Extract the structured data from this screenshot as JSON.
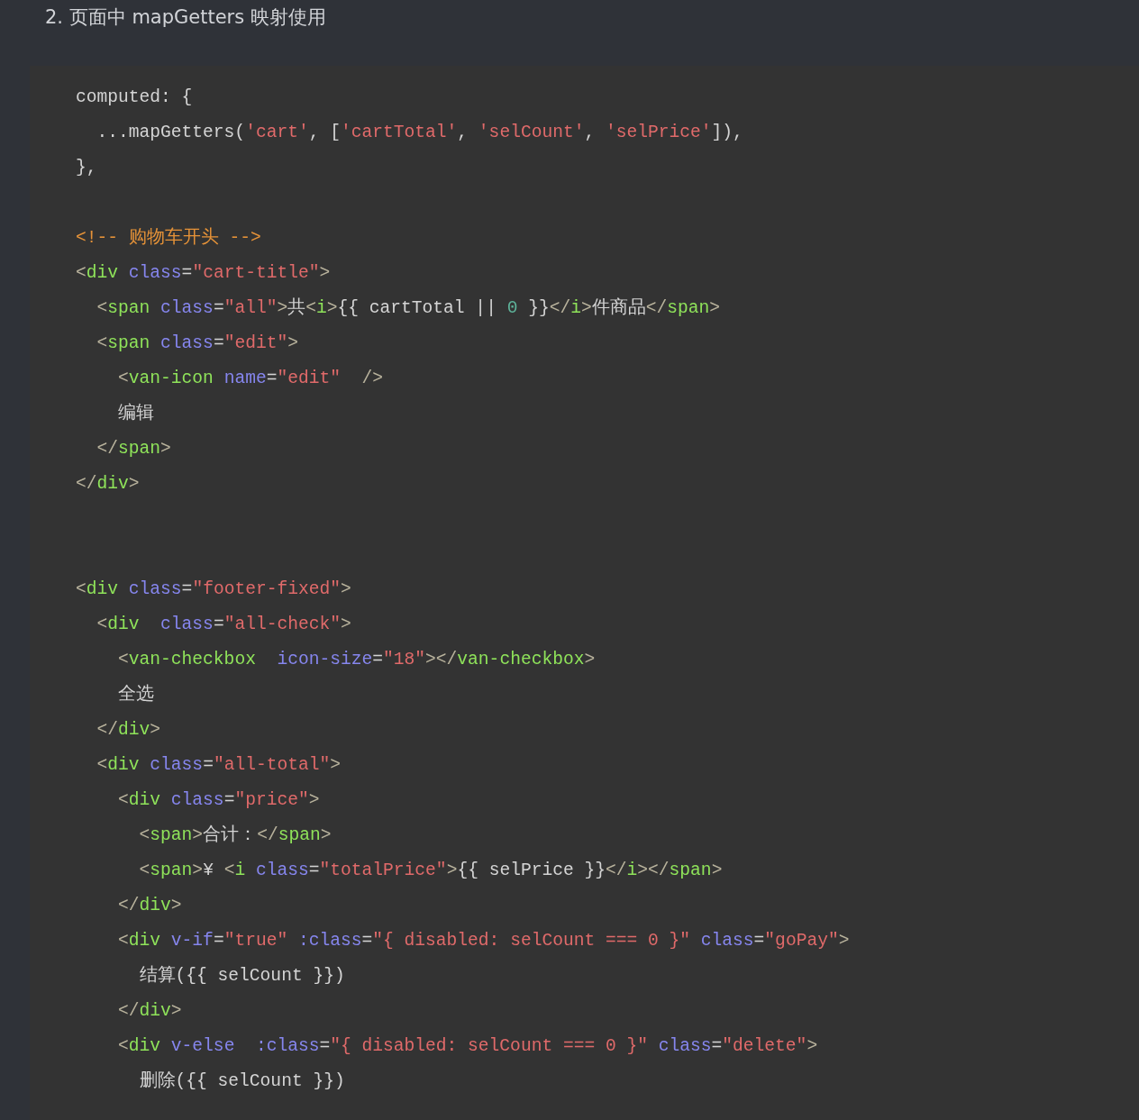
{
  "heading": "2. 页面中 mapGetters 映射使用",
  "code": {
    "lines": [
      {
        "kind": "code",
        "tokens": [
          {
            "kind": "plain",
            "text": "computed: {"
          }
        ]
      },
      {
        "kind": "code",
        "tokens": [
          {
            "kind": "plain",
            "text": "  ...mapGetters("
          },
          {
            "kind": "string",
            "text": "'cart'"
          },
          {
            "kind": "plain",
            "text": ", ["
          },
          {
            "kind": "string",
            "text": "'cartTotal'"
          },
          {
            "kind": "plain",
            "text": ", "
          },
          {
            "kind": "string",
            "text": "'selCount'"
          },
          {
            "kind": "plain",
            "text": ", "
          },
          {
            "kind": "string",
            "text": "'selPrice'"
          },
          {
            "kind": "plain",
            "text": "]),"
          }
        ]
      },
      {
        "kind": "code",
        "tokens": [
          {
            "kind": "plain",
            "text": "},"
          }
        ]
      },
      {
        "kind": "blank"
      },
      {
        "kind": "code",
        "tokens": [
          {
            "kind": "comment",
            "text": "<!-- 购物车开头 -->"
          }
        ]
      },
      {
        "kind": "code",
        "tokens": [
          {
            "kind": "bracket",
            "text": "<"
          },
          {
            "kind": "tag",
            "text": "div"
          },
          {
            "kind": "attr",
            "text": " class"
          },
          {
            "kind": "plain",
            "text": "="
          },
          {
            "kind": "string",
            "text": "\"cart-title\""
          },
          {
            "kind": "bracket",
            "text": ">"
          }
        ]
      },
      {
        "kind": "code",
        "tokens": [
          {
            "kind": "bracket",
            "text": "  <"
          },
          {
            "kind": "tag",
            "text": "span"
          },
          {
            "kind": "attr",
            "text": " class"
          },
          {
            "kind": "plain",
            "text": "="
          },
          {
            "kind": "string",
            "text": "\"all\""
          },
          {
            "kind": "bracket",
            "text": ">"
          },
          {
            "kind": "plain",
            "text": "共"
          },
          {
            "kind": "bracket",
            "text": "<"
          },
          {
            "kind": "tag",
            "text": "i"
          },
          {
            "kind": "bracket",
            "text": ">"
          },
          {
            "kind": "plain",
            "text": "{{ cartTotal || "
          },
          {
            "kind": "number",
            "text": "0"
          },
          {
            "kind": "plain",
            "text": " }}"
          },
          {
            "kind": "bracket",
            "text": "</"
          },
          {
            "kind": "tag",
            "text": "i"
          },
          {
            "kind": "bracket",
            "text": ">"
          },
          {
            "kind": "plain",
            "text": "件商品"
          },
          {
            "kind": "bracket",
            "text": "</"
          },
          {
            "kind": "tag",
            "text": "span"
          },
          {
            "kind": "bracket",
            "text": ">"
          }
        ]
      },
      {
        "kind": "code",
        "tokens": [
          {
            "kind": "bracket",
            "text": "  <"
          },
          {
            "kind": "tag",
            "text": "span"
          },
          {
            "kind": "attr",
            "text": " class"
          },
          {
            "kind": "plain",
            "text": "="
          },
          {
            "kind": "string",
            "text": "\"edit\""
          },
          {
            "kind": "bracket",
            "text": ">"
          }
        ]
      },
      {
        "kind": "code",
        "tokens": [
          {
            "kind": "bracket",
            "text": "    <"
          },
          {
            "kind": "tag",
            "text": "van-icon"
          },
          {
            "kind": "attr",
            "text": " name"
          },
          {
            "kind": "plain",
            "text": "="
          },
          {
            "kind": "string",
            "text": "\"edit\""
          },
          {
            "kind": "bracket",
            "text": "  />"
          }
        ]
      },
      {
        "kind": "code",
        "tokens": [
          {
            "kind": "plain",
            "text": "    编辑"
          }
        ]
      },
      {
        "kind": "code",
        "tokens": [
          {
            "kind": "bracket",
            "text": "  </"
          },
          {
            "kind": "tag",
            "text": "span"
          },
          {
            "kind": "bracket",
            "text": ">"
          }
        ]
      },
      {
        "kind": "code",
        "tokens": [
          {
            "kind": "bracket",
            "text": "</"
          },
          {
            "kind": "tag",
            "text": "div"
          },
          {
            "kind": "bracket",
            "text": ">"
          }
        ]
      },
      {
        "kind": "blank"
      },
      {
        "kind": "blank"
      },
      {
        "kind": "code",
        "tokens": [
          {
            "kind": "bracket",
            "text": "<"
          },
          {
            "kind": "tag",
            "text": "div"
          },
          {
            "kind": "attr",
            "text": " class"
          },
          {
            "kind": "plain",
            "text": "="
          },
          {
            "kind": "string",
            "text": "\"footer-fixed\""
          },
          {
            "kind": "bracket",
            "text": ">"
          }
        ]
      },
      {
        "kind": "code",
        "tokens": [
          {
            "kind": "bracket",
            "text": "  <"
          },
          {
            "kind": "tag",
            "text": "div"
          },
          {
            "kind": "attr",
            "text": "  class"
          },
          {
            "kind": "plain",
            "text": "="
          },
          {
            "kind": "string",
            "text": "\"all-check\""
          },
          {
            "kind": "bracket",
            "text": ">"
          }
        ]
      },
      {
        "kind": "code",
        "tokens": [
          {
            "kind": "bracket",
            "text": "    <"
          },
          {
            "kind": "tag",
            "text": "van-checkbox"
          },
          {
            "kind": "attr",
            "text": "  icon-size"
          },
          {
            "kind": "plain",
            "text": "="
          },
          {
            "kind": "string",
            "text": "\"18\""
          },
          {
            "kind": "bracket",
            "text": "></"
          },
          {
            "kind": "tag",
            "text": "van-checkbox"
          },
          {
            "kind": "bracket",
            "text": ">"
          }
        ]
      },
      {
        "kind": "code",
        "tokens": [
          {
            "kind": "plain",
            "text": "    全选"
          }
        ]
      },
      {
        "kind": "code",
        "tokens": [
          {
            "kind": "bracket",
            "text": "  </"
          },
          {
            "kind": "tag",
            "text": "div"
          },
          {
            "kind": "bracket",
            "text": ">"
          }
        ]
      },
      {
        "kind": "code",
        "tokens": [
          {
            "kind": "bracket",
            "text": "  <"
          },
          {
            "kind": "tag",
            "text": "div"
          },
          {
            "kind": "attr",
            "text": " class"
          },
          {
            "kind": "plain",
            "text": "="
          },
          {
            "kind": "string",
            "text": "\"all-total\""
          },
          {
            "kind": "bracket",
            "text": ">"
          }
        ]
      },
      {
        "kind": "code",
        "tokens": [
          {
            "kind": "bracket",
            "text": "    <"
          },
          {
            "kind": "tag",
            "text": "div"
          },
          {
            "kind": "attr",
            "text": " class"
          },
          {
            "kind": "plain",
            "text": "="
          },
          {
            "kind": "string",
            "text": "\"price\""
          },
          {
            "kind": "bracket",
            "text": ">"
          }
        ]
      },
      {
        "kind": "code",
        "tokens": [
          {
            "kind": "bracket",
            "text": "      <"
          },
          {
            "kind": "tag",
            "text": "span"
          },
          {
            "kind": "bracket",
            "text": ">"
          },
          {
            "kind": "plain",
            "text": "合计："
          },
          {
            "kind": "bracket",
            "text": "</"
          },
          {
            "kind": "tag",
            "text": "span"
          },
          {
            "kind": "bracket",
            "text": ">"
          }
        ]
      },
      {
        "kind": "code",
        "tokens": [
          {
            "kind": "bracket",
            "text": "      <"
          },
          {
            "kind": "tag",
            "text": "span"
          },
          {
            "kind": "bracket",
            "text": ">"
          },
          {
            "kind": "plain",
            "text": "¥ "
          },
          {
            "kind": "bracket",
            "text": "<"
          },
          {
            "kind": "tag",
            "text": "i"
          },
          {
            "kind": "attr",
            "text": " class"
          },
          {
            "kind": "plain",
            "text": "="
          },
          {
            "kind": "string",
            "text": "\"totalPrice\""
          },
          {
            "kind": "bracket",
            "text": ">"
          },
          {
            "kind": "plain",
            "text": "{{ selPrice }}"
          },
          {
            "kind": "bracket",
            "text": "</"
          },
          {
            "kind": "tag",
            "text": "i"
          },
          {
            "kind": "bracket",
            "text": "></"
          },
          {
            "kind": "tag",
            "text": "span"
          },
          {
            "kind": "bracket",
            "text": ">"
          }
        ]
      },
      {
        "kind": "code",
        "tokens": [
          {
            "kind": "bracket",
            "text": "    </"
          },
          {
            "kind": "tag",
            "text": "div"
          },
          {
            "kind": "bracket",
            "text": ">"
          }
        ]
      },
      {
        "kind": "code",
        "tokens": [
          {
            "kind": "bracket",
            "text": "    <"
          },
          {
            "kind": "tag",
            "text": "div"
          },
          {
            "kind": "attr",
            "text": " v-if"
          },
          {
            "kind": "plain",
            "text": "="
          },
          {
            "kind": "string",
            "text": "\"true\""
          },
          {
            "kind": "attr",
            "text": " :class"
          },
          {
            "kind": "plain",
            "text": "="
          },
          {
            "kind": "string",
            "text": "\"{ disabled: selCount === 0 }\""
          },
          {
            "kind": "attr",
            "text": " class"
          },
          {
            "kind": "plain",
            "text": "="
          },
          {
            "kind": "string",
            "text": "\"goPay\""
          },
          {
            "kind": "bracket",
            "text": ">"
          }
        ]
      },
      {
        "kind": "code",
        "tokens": [
          {
            "kind": "plain",
            "text": "      结算({{ selCount }})"
          }
        ]
      },
      {
        "kind": "code",
        "tokens": [
          {
            "kind": "bracket",
            "text": "    </"
          },
          {
            "kind": "tag",
            "text": "div"
          },
          {
            "kind": "bracket",
            "text": ">"
          }
        ]
      },
      {
        "kind": "code",
        "tokens": [
          {
            "kind": "bracket",
            "text": "    <"
          },
          {
            "kind": "tag",
            "text": "div"
          },
          {
            "kind": "attr",
            "text": " v-else"
          },
          {
            "kind": "attr",
            "text": "  :class"
          },
          {
            "kind": "plain",
            "text": "="
          },
          {
            "kind": "string",
            "text": "\"{ disabled: selCount === 0 }\""
          },
          {
            "kind": "attr",
            "text": " class"
          },
          {
            "kind": "plain",
            "text": "="
          },
          {
            "kind": "string",
            "text": "\"delete\""
          },
          {
            "kind": "bracket",
            "text": ">"
          }
        ]
      },
      {
        "kind": "code",
        "tokens": [
          {
            "kind": "plain",
            "text": "      删除({{ selCount }})"
          }
        ]
      }
    ]
  }
}
